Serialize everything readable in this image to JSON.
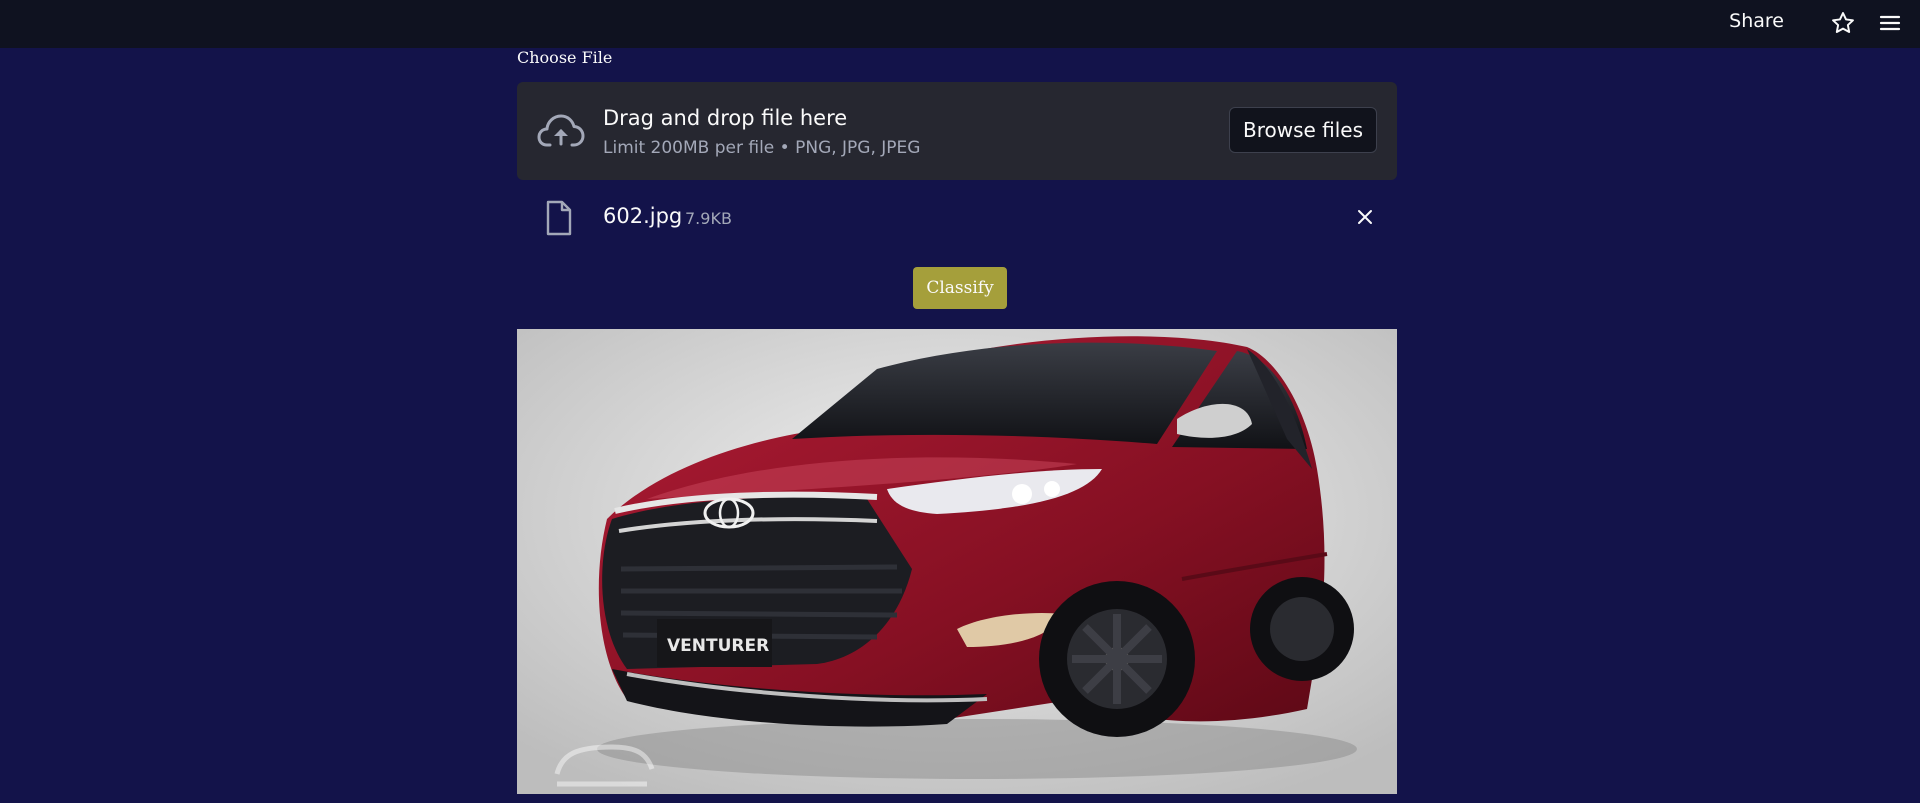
{
  "header": {
    "share_label": "Share",
    "icons": [
      "star-icon",
      "hamburger-menu-icon"
    ]
  },
  "uploader": {
    "label": "Choose File",
    "dropzone_title": "Drag and drop file here",
    "dropzone_subtitle": "Limit 200MB per file • PNG, JPG, JPEG",
    "browse_label": "Browse files",
    "upload_icon": "cloud-upload-icon"
  },
  "uploaded_file": {
    "name": "602.jpg",
    "size": "7.9KB",
    "file_icon": "file-icon",
    "remove_icon": "close-icon"
  },
  "actions": {
    "classify_label": "Classify"
  },
  "preview": {
    "plate_text": "VENTURER",
    "colors": {
      "body": "#8e1226",
      "background": "#d8d8d8"
    }
  },
  "colors": {
    "page_background": "#13134a",
    "topbar": "#0f1220",
    "dropzone": "#262730",
    "classify_button": "#a59f3b"
  }
}
